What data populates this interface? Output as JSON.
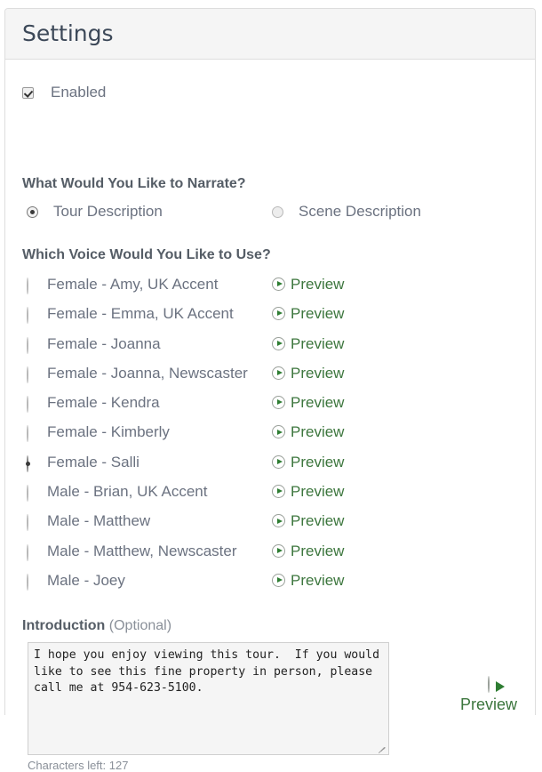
{
  "panel": {
    "title": "Settings"
  },
  "enabled": {
    "label": "Enabled",
    "checked": true
  },
  "narrate": {
    "heading": "What Would You Like to Narrate?",
    "options": [
      {
        "label": "Tour Description",
        "selected": true
      },
      {
        "label": "Scene Description",
        "selected": false
      }
    ]
  },
  "voice": {
    "heading": "Which Voice Would You Like to Use?",
    "preview_label": "Preview",
    "options": [
      {
        "label": "Female - Amy, UK Accent",
        "selected": false
      },
      {
        "label": "Female - Emma, UK Accent",
        "selected": false
      },
      {
        "label": "Female - Joanna",
        "selected": false
      },
      {
        "label": "Female - Joanna, Newscaster",
        "selected": false
      },
      {
        "label": "Female - Kendra",
        "selected": false
      },
      {
        "label": "Female - Kimberly",
        "selected": false
      },
      {
        "label": "Female - Salli",
        "selected": true
      },
      {
        "label": "Male - Brian, UK Accent",
        "selected": false
      },
      {
        "label": "Male - Matthew",
        "selected": false
      },
      {
        "label": "Male - Matthew, Newscaster",
        "selected": false
      },
      {
        "label": "Male - Joey",
        "selected": false
      }
    ]
  },
  "introduction": {
    "heading": "Introduction",
    "heading_suffix": "(Optional)",
    "value": "I hope you enjoy viewing this tour.  If you would like to see this fine property in person, please call me at 954-623-5100.",
    "characters_left": "Characters left: 127",
    "preview_label": "Preview"
  },
  "colors": {
    "link_green": "#3c763d",
    "play_green": "#2e7d32",
    "heading_gray": "#555d66",
    "text_gray": "#6b7280",
    "panel_border": "#dddddd",
    "panel_header_bg": "#f5f5f5"
  }
}
